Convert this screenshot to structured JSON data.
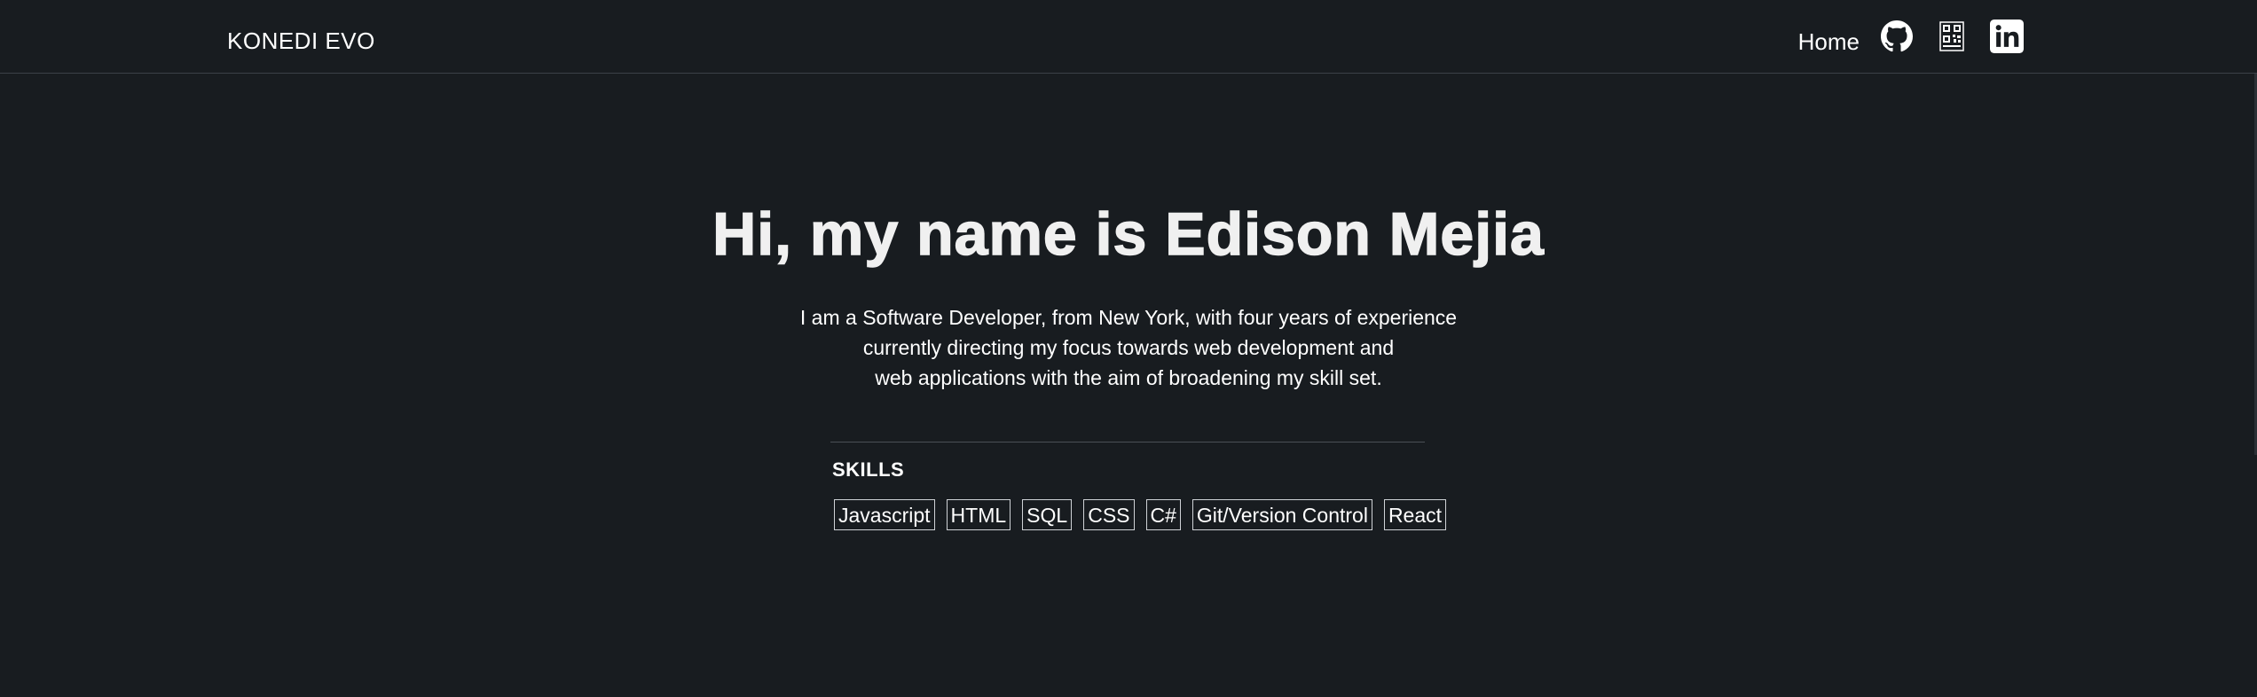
{
  "nav": {
    "brand": "KONEDI EVO",
    "home_label": "Home",
    "icons": [
      "github-icon",
      "qr-code-icon",
      "linkedin-icon"
    ]
  },
  "hero": {
    "heading": "Hi, my name is Edison Mejia",
    "intro_lines": [
      "I am a Software Developer, from New York, with four years of experience",
      "currently directing my focus towards web development and",
      "web applications with the aim of broadening my skill set."
    ]
  },
  "skills": {
    "title": "SKILLS",
    "items": [
      "Javascript",
      "HTML",
      "SQL",
      "CSS",
      "C#",
      "Git/Version Control",
      "React"
    ]
  },
  "colors": {
    "background": "#181c20",
    "text": "#ffffff",
    "divider": "#3c4148"
  }
}
